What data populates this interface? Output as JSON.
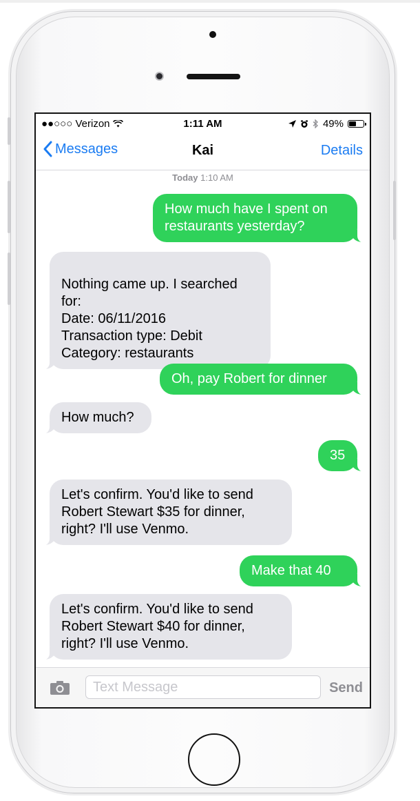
{
  "status_bar": {
    "carrier": "●●○○○ Verizon",
    "time": "1:11 AM",
    "battery_percent": "49%",
    "battery_level": 0.49,
    "icons": [
      "wifi-icon",
      "location-arrow-icon",
      "alarm-icon",
      "bluetooth-icon",
      "battery-icon"
    ]
  },
  "nav": {
    "back_label": "Messages",
    "title": "Kai",
    "details_label": "Details"
  },
  "thread": {
    "timestamp_day": "Today",
    "timestamp_time": "1:10 AM",
    "messages": [
      {
        "dir": "out",
        "text": "How much have I spent on restaurants yesterday?"
      },
      {
        "dir": "in",
        "text": "Nothing came up. I searched for:\nDate: 06/11/2016\nTransaction type: Debit\nCategory: restaurants"
      },
      {
        "dir": "out",
        "text": "Oh, pay Robert for dinner"
      },
      {
        "dir": "in",
        "text": "How much?"
      },
      {
        "dir": "out",
        "text": "35"
      },
      {
        "dir": "in",
        "text": "Let's confirm. You'd like to send Robert Stewart $35 for dinner, right? I'll use Venmo."
      },
      {
        "dir": "out",
        "text": "Make that 40"
      },
      {
        "dir": "in",
        "text": "Let's confirm. You'd like to send Robert Stewart $40 for dinner, right? I'll use Venmo."
      }
    ]
  },
  "composer": {
    "placeholder": "Text Message",
    "send_label": "Send"
  },
  "colors": {
    "outgoing_bubble": "#2fd25a",
    "incoming_bubble": "#e5e5ea",
    "accent": "#1b7cf2"
  }
}
